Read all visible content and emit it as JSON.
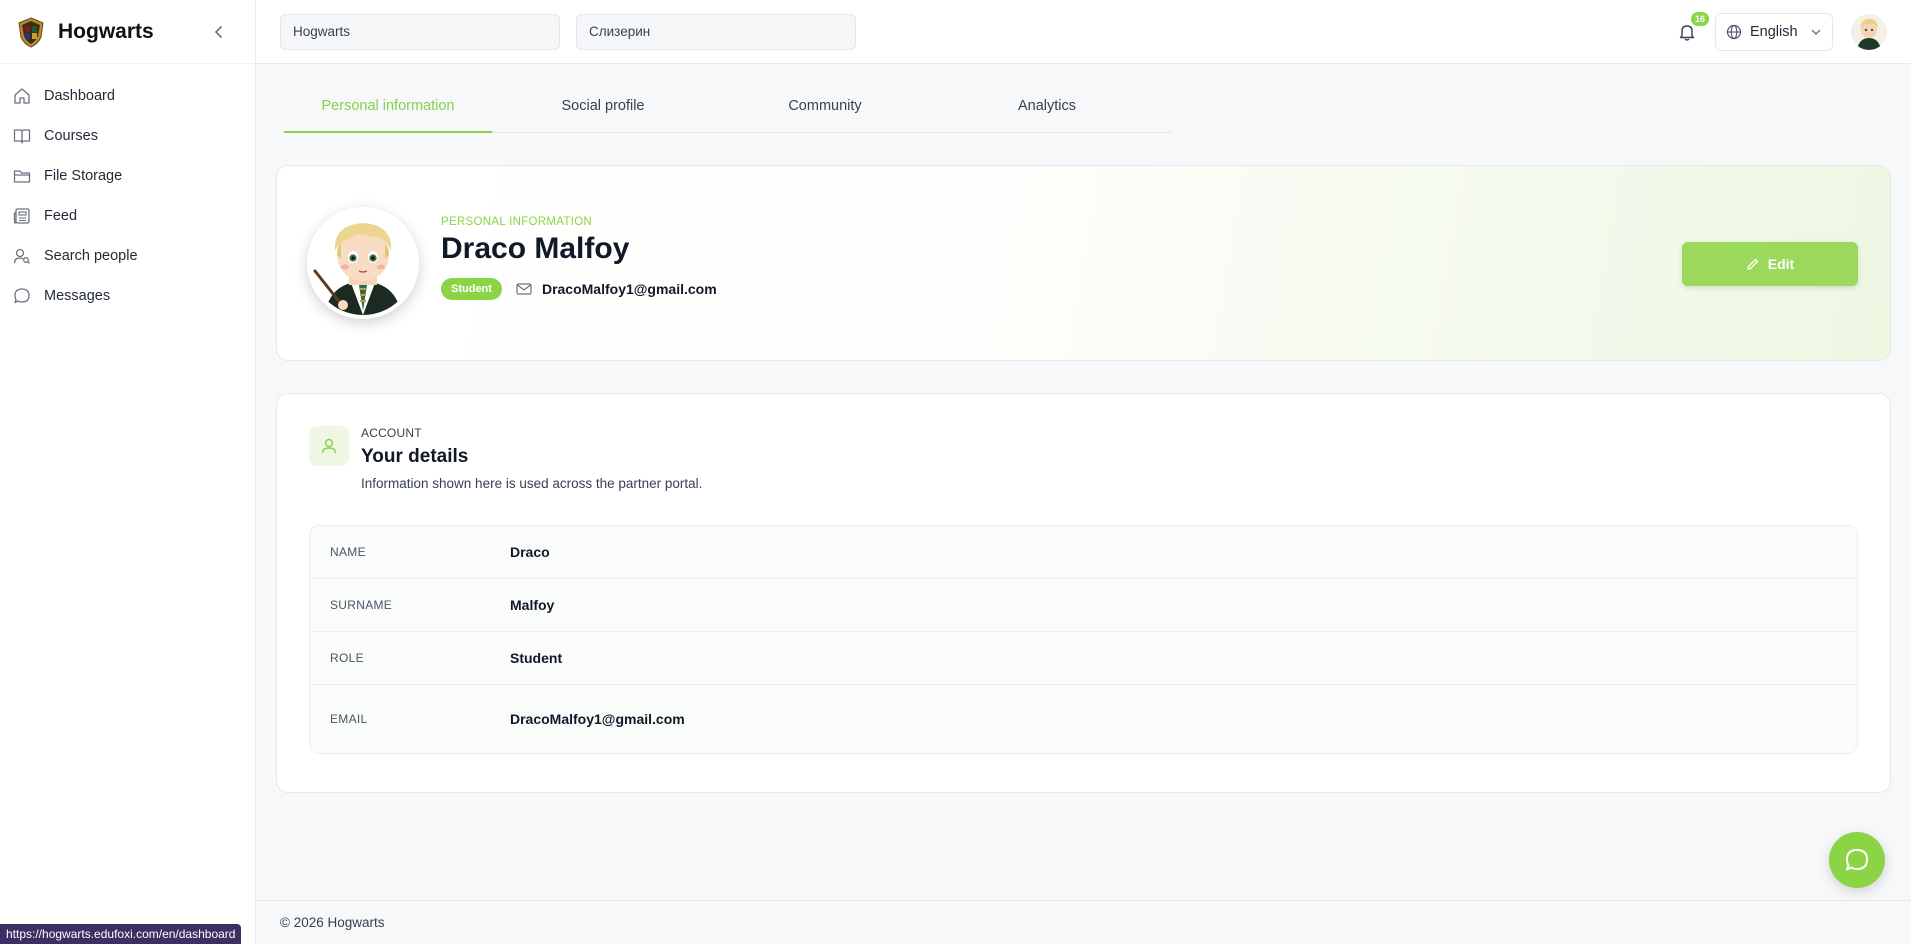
{
  "app": {
    "name": "Hogwarts"
  },
  "sidebar": {
    "items": [
      {
        "label": "Dashboard",
        "icon": "home-icon"
      },
      {
        "label": "Courses",
        "icon": "book-icon"
      },
      {
        "label": "File Storage",
        "icon": "folder-icon"
      },
      {
        "label": "Feed",
        "icon": "newspaper-icon"
      },
      {
        "label": "Search people",
        "icon": "user-search-icon"
      },
      {
        "label": "Messages",
        "icon": "chat-bubble-icon"
      }
    ]
  },
  "topbar": {
    "school_field": "Hogwarts",
    "house_field": "Слизерин",
    "notifications_count": "16",
    "language": "English"
  },
  "tabs": [
    "Personal information",
    "Social profile",
    "Community",
    "Analytics"
  ],
  "profile": {
    "eyebrow": "PERSONAL INFORMATION",
    "name": "Draco Malfoy",
    "role_badge": "Student",
    "email": "DracoMalfoy1@gmail.com",
    "edit_label": "Edit"
  },
  "account": {
    "eyebrow": "ACCOUNT",
    "title": "Your details",
    "subtitle": "Information shown here is used across the partner portal.",
    "rows": [
      {
        "label": "NAME",
        "value": "Draco"
      },
      {
        "label": "SURNAME",
        "value": "Malfoy"
      },
      {
        "label": "ROLE",
        "value": "Student"
      },
      {
        "label": "EMAIL",
        "value": "DracoMalfoy1@gmail.com"
      }
    ]
  },
  "footer": {
    "copyright": "© 2026 Hogwarts"
  },
  "status_bar": {
    "url": "https://hogwarts.edufoxi.com/en/dashboard"
  },
  "colors": {
    "accent": "#8bd446",
    "text": "#111827"
  }
}
